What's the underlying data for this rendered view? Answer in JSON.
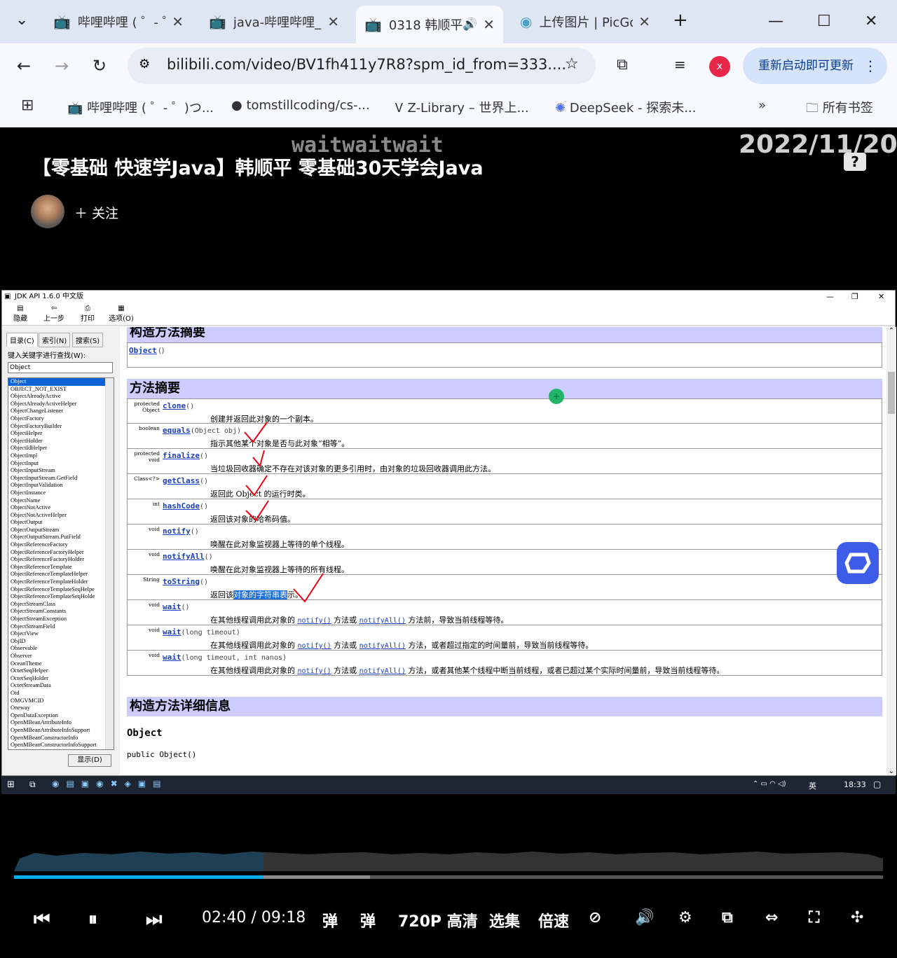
{
  "browser": {
    "tabs": [
      {
        "title": "哔哩哔哩 ( ゜- ゜)つロ 干杯~-bilibili",
        "active": false
      },
      {
        "title": "java-哔哩哔哩_bilibili",
        "active": false
      },
      {
        "title": "0318 韩顺平",
        "active": true
      },
      {
        "title": "上传图片 | PicGo",
        "active": false
      }
    ],
    "url": "bilibili.com/video/BV1fh411y7R8?spm_id_from=333....",
    "profile_initial": "x",
    "update_label": "重新启动即可更新",
    "bookmarks": [
      "哔哩哔哩 ( ゜- ゜)つ...",
      "tomstillcoding/cs-...",
      "Z-Library – 世界上...",
      "DeepSeek - 探索未..."
    ],
    "all_bookmarks": "所有书签",
    "more_bookmarks": "»"
  },
  "video": {
    "title": "【零基础 快速学Java】韩顺平 零基础30天学会Java",
    "watermark": "waitwaitwait",
    "date": "2022/11/20",
    "follow_label": "关注",
    "help_icon": "?"
  },
  "jdk": {
    "window_title": "JDK API 1.6.0 中文版",
    "tools": [
      "隐藏",
      "上一步",
      "打印",
      "选项(O)"
    ],
    "left_tabs": [
      "目录(C)",
      "索引(N)",
      "搜索(S)"
    ],
    "keyword_label": "键入关键字进行查找(W):",
    "keyword_value": "Object",
    "show_button": "显示(D)",
    "index_items": [
      "Object",
      "OBJECT_NOT_EXIST",
      "ObjectAlreadyActive",
      "ObjectAlreadyActiveHelper",
      "ObjectChangeListener",
      "ObjectFactory",
      "ObjectFactoryBuilder",
      "ObjectHelper",
      "ObjectHolder",
      "ObjectIdHelper",
      "ObjectImpl",
      "ObjectInput",
      "ObjectInputStream",
      "ObjectInputStream.GetField",
      "ObjectInputValidation",
      "ObjectInstance",
      "ObjectName",
      "ObjectNotActive",
      "ObjectNotActiveHelper",
      "ObjectOutput",
      "ObjectOutputStream",
      "ObjectOutputStream.PutField",
      "ObjectReferenceFactory",
      "ObjectReferenceFactoryHelper",
      "ObjectReferenceFactoryHolder",
      "ObjectReferenceTemplate",
      "ObjectReferenceTemplateHelper",
      "ObjectReferenceTemplateHolder",
      "ObjectReferenceTemplateSeqHelpe",
      "ObjectReferenceTemplateSeqHolde",
      "ObjectStreamClass",
      "ObjectStreamConstants",
      "ObjectStreamException",
      "ObjectStreamField",
      "ObjectView",
      "ObjID",
      "Observable",
      "Observer",
      "OceanTheme",
      "OctetSeqHelper",
      "OctetSeqHolder",
      "OctetStreamData",
      "Oid",
      "OMGVMCID",
      "Oneway",
      "OpenDataException",
      "OpenMBeanAttributeInfo",
      "OpenMBeanAttributeInfoSupport",
      "OpenMBeanConstructorInfo",
      "OpenMBeanConstructorInfoSupport"
    ],
    "constructor_summary_title": "构造方法摘要",
    "constructor_sig": "Object",
    "method_summary_title": "方法摘要",
    "methods": [
      {
        "mod": "protected Object",
        "name": "clone",
        "params": "()",
        "desc": "创建并返回此对象的一个副本。"
      },
      {
        "mod": "boolean",
        "name": "equals",
        "params": "(Object obj)",
        "desc": "指示其他某个对象是否与此对象“相等”。"
      },
      {
        "mod": "protected void",
        "name": "finalize",
        "params": "()",
        "desc": "当垃圾回收器确定不存在对该对象的更多引用时，由对象的垃圾回收器调用此方法。"
      },
      {
        "mod": "Class<?>",
        "name": "getClass",
        "params": "()",
        "desc": "返回此 Object 的运行时类。"
      },
      {
        "mod": "int",
        "name": "hashCode",
        "params": "()",
        "desc": "返回该对象的哈希码值。"
      },
      {
        "mod": "void",
        "name": "notify",
        "params": "()",
        "desc": "唤醒在此对象监视器上等待的单个线程。"
      },
      {
        "mod": "void",
        "name": "notifyAll",
        "params": "()",
        "desc": "唤醒在此对象监视器上等待的所有线程。"
      },
      {
        "mod": "String",
        "name": "toString",
        "params": "()",
        "desc_pre": "返回该",
        "desc_hl": "对象的字符串表",
        "desc_post": "示。"
      },
      {
        "mod": "void",
        "name": "wait",
        "params": "()",
        "desc_a": "在其他线程调用此对象的",
        "link1": "notify()",
        "desc_b": "方法或",
        "link2": "notifyAll()",
        "desc_c": "方法前，导致当前线程等待。"
      },
      {
        "mod": "void",
        "name": "wait",
        "params": "(long timeout)",
        "desc_a": "在其他线程调用此对象的",
        "link1": "notify()",
        "desc_b": "方法或",
        "link2": "notifyAll()",
        "desc_c": "方法，或者超过指定的时间量前，导致当前线程等待。"
      },
      {
        "mod": "void",
        "name": "wait",
        "params": "(long timeout, int nanos)",
        "desc_a": "在其他线程调用此对象的",
        "link1": "notify()",
        "desc_b": "方法或",
        "link2": "notifyAll()",
        "desc_c": "方法，或者其他某个线程中断当前线程，或者已超过某个实际时间量前，导致当前线程等待。"
      }
    ],
    "constructor_detail_title": "构造方法详细信息",
    "constructor_detail_name": "Object",
    "constructor_detail_sig": "public Object()"
  },
  "taskbar": {
    "time": "18:33",
    "ime": "英"
  },
  "player": {
    "current_time": "02:40",
    "separator": "/",
    "duration": "09:18",
    "played_fraction": 0.287,
    "buffered_fraction": 0.41,
    "quality": "720P 高清",
    "episodes": "选集",
    "speed": "倍速"
  }
}
